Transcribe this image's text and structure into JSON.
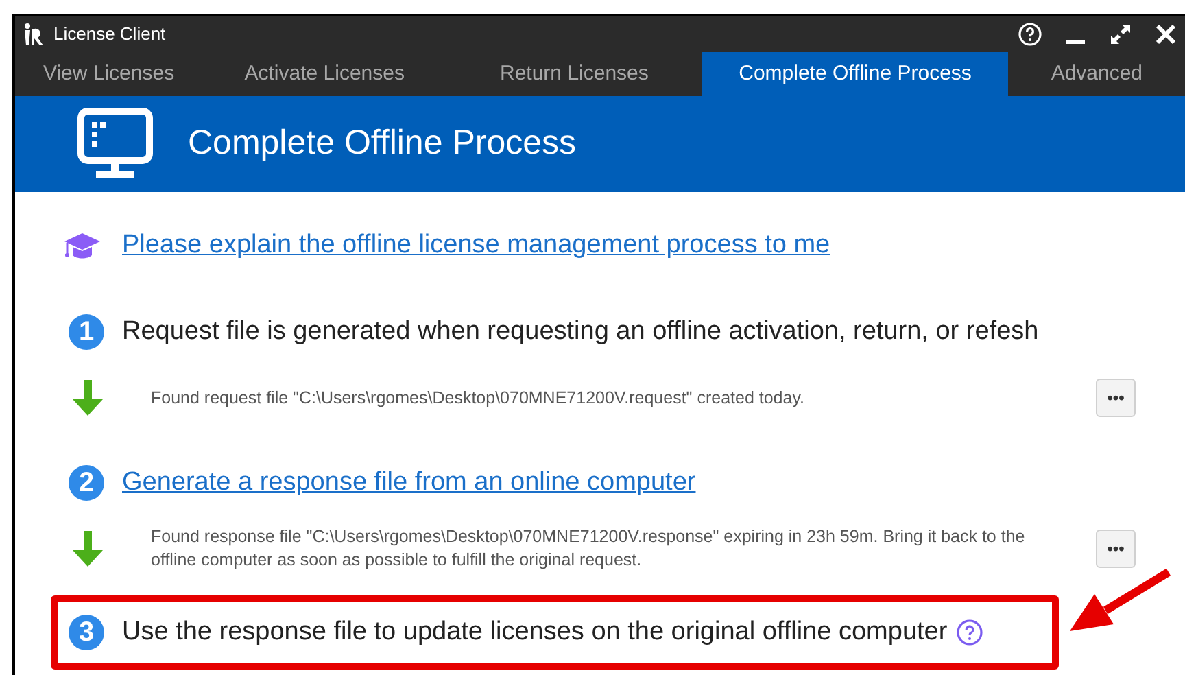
{
  "window": {
    "title": "License Client"
  },
  "tabs": [
    {
      "label": "View Licenses",
      "selected": false
    },
    {
      "label": "Activate Licenses",
      "selected": false
    },
    {
      "label": "Return Licenses",
      "selected": false
    },
    {
      "label": "Complete Offline Process",
      "selected": true
    },
    {
      "label": "Advanced",
      "selected": false
    }
  ],
  "banner": {
    "title": "Complete Offline Process"
  },
  "explain_link": "Please explain the offline license management process to me",
  "steps": [
    {
      "number": "1",
      "kind": "plain",
      "text": "Request file is generated when requesting an offline activation, return, or refesh",
      "help": false,
      "highlighted": false,
      "result": {
        "text": "Found request file \"C:\\Users\\rgomes\\Desktop\\070MNE71200V.request\" created today.",
        "more": "•••"
      }
    },
    {
      "number": "2",
      "kind": "link",
      "text": "Generate a response file from an online computer",
      "help": false,
      "highlighted": false,
      "result": {
        "text": "Found response file \"C:\\Users\\rgomes\\Desktop\\070MNE71200V.response\" expiring in 23h 59m. Bring it back to the offline computer as soon as possible to fulfill the original request.",
        "more": "•••"
      }
    },
    {
      "number": "3",
      "kind": "plain",
      "text": "Use the response file to update licenses on the original offline computer",
      "help": true,
      "highlighted": true
    }
  ]
}
